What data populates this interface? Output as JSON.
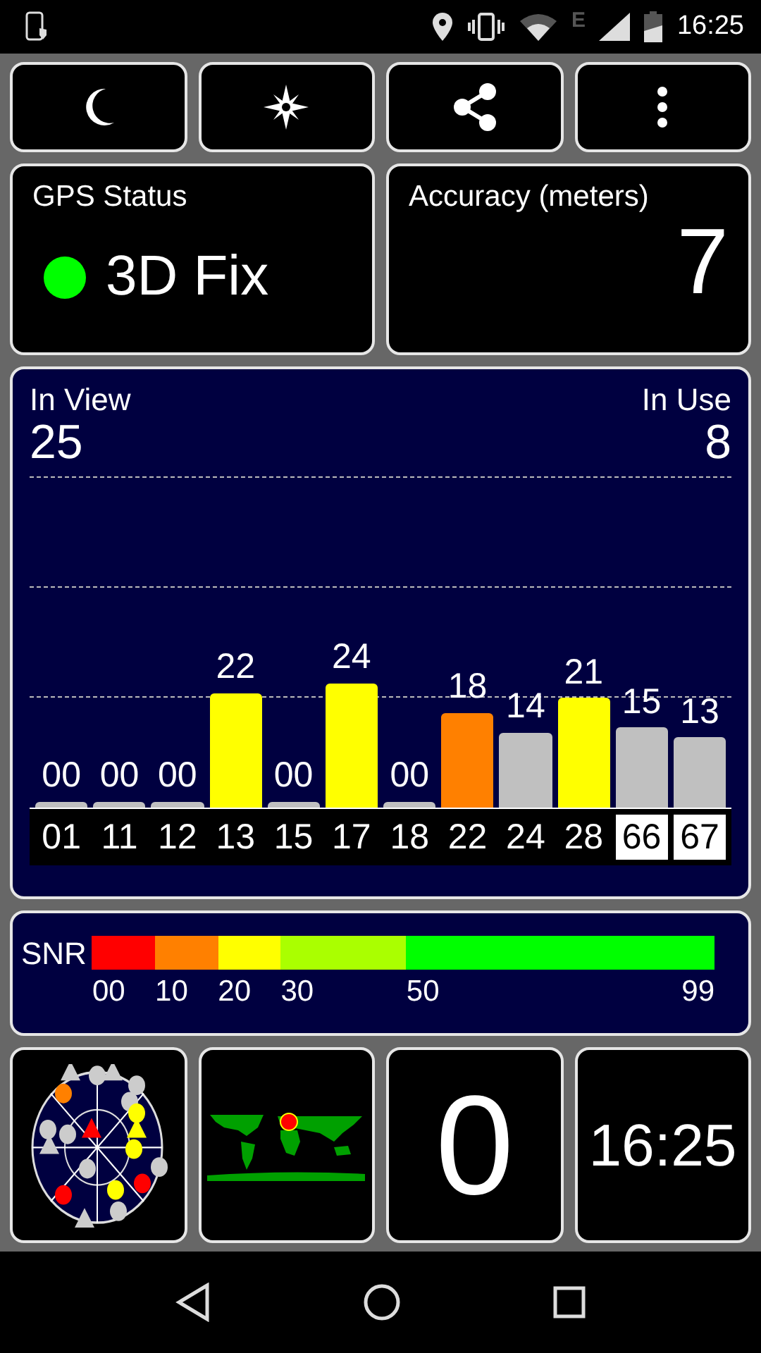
{
  "status_bar": {
    "network": "E",
    "time": "16:25"
  },
  "toolbar": [
    {
      "kind": "night"
    },
    {
      "kind": "compass"
    },
    {
      "kind": "share"
    },
    {
      "kind": "menu"
    }
  ],
  "gps_status": {
    "title": "GPS Status",
    "value": "3D Fix",
    "color": "#00ff00"
  },
  "accuracy": {
    "title": "Accuracy (meters)",
    "value": "7"
  },
  "satellites_panel": {
    "in_view_label": "In View",
    "in_view": "25",
    "in_use_label": "In Use",
    "in_use": "8",
    "satellites": [
      {
        "prn": "01",
        "snr": "00",
        "color": "#c0c0c0",
        "highlighted": false
      },
      {
        "prn": "11",
        "snr": "00",
        "color": "#c0c0c0",
        "highlighted": false
      },
      {
        "prn": "12",
        "snr": "00",
        "color": "#c0c0c0",
        "highlighted": false
      },
      {
        "prn": "13",
        "snr": "22",
        "color": "#ffff00",
        "highlighted": false
      },
      {
        "prn": "15",
        "snr": "00",
        "color": "#c0c0c0",
        "highlighted": false
      },
      {
        "prn": "17",
        "snr": "24",
        "color": "#ffff00",
        "highlighted": false
      },
      {
        "prn": "18",
        "snr": "00",
        "color": "#c0c0c0",
        "highlighted": false
      },
      {
        "prn": "22",
        "snr": "18",
        "color": "#ff8000",
        "highlighted": false
      },
      {
        "prn": "24",
        "snr": "14",
        "color": "#c0c0c0",
        "highlighted": false
      },
      {
        "prn": "28",
        "snr": "21",
        "color": "#ffff00",
        "highlighted": false
      },
      {
        "prn": "66",
        "snr": "15",
        "color": "#c0c0c0",
        "highlighted": true
      },
      {
        "prn": "67",
        "snr": "13",
        "color": "#c0c0c0",
        "highlighted": true
      }
    ]
  },
  "snr_legend": {
    "label": "SNR",
    "segments": [
      {
        "tick": "00",
        "color": "#ff0000"
      },
      {
        "tick": "10",
        "color": "#ff8000"
      },
      {
        "tick": "20",
        "color": "#ffff00"
      },
      {
        "tick": "30",
        "color": "#aaff00"
      },
      {
        "tick": "50",
        "color": "#00ff00"
      }
    ],
    "end_tick": "99"
  },
  "bottom": {
    "count": "0",
    "time": "16:25"
  }
}
